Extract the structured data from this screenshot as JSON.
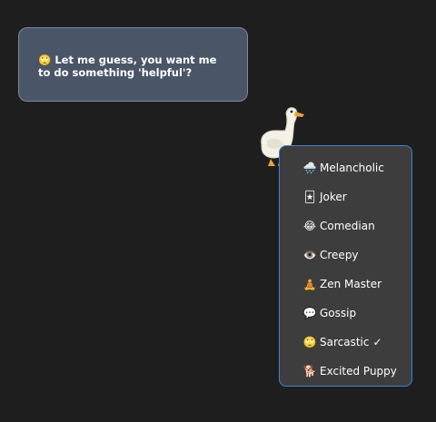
{
  "bubble": {
    "emoji": "🙄",
    "text": "Let me guess, you want me to do something 'helpful'?"
  },
  "goose": {
    "icon": "goose-icon"
  },
  "menu": {
    "items": [
      {
        "icon": "🌧️",
        "icon_name": "rain-cloud-icon",
        "label": "Melancholic",
        "checked": ""
      },
      {
        "icon": "🃏",
        "icon_name": "joker-card-icon",
        "label": "Joker",
        "checked": ""
      },
      {
        "icon": "😂",
        "icon_name": "laughing-face-icon",
        "label": "Comedian",
        "checked": ""
      },
      {
        "icon": "👁️",
        "icon_name": "eye-icon",
        "label": "Creepy",
        "checked": ""
      },
      {
        "icon": "🧘",
        "icon_name": "meditation-icon",
        "label": "Zen Master",
        "checked": ""
      },
      {
        "icon": "💬",
        "icon_name": "speech-bubble-icon",
        "label": "Gossip",
        "checked": ""
      },
      {
        "icon": "🙄",
        "icon_name": "eye-roll-icon",
        "label": "Sarcastic",
        "checked": "✓"
      },
      {
        "icon": "🐕",
        "icon_name": "dog-icon",
        "label": "Excited Puppy",
        "checked": ""
      }
    ]
  },
  "colors": {
    "background": "#1e1e1e",
    "bubble_bg": "#4a5567",
    "menu_bg": "#3d3d3d",
    "menu_border": "#3e82d6"
  }
}
